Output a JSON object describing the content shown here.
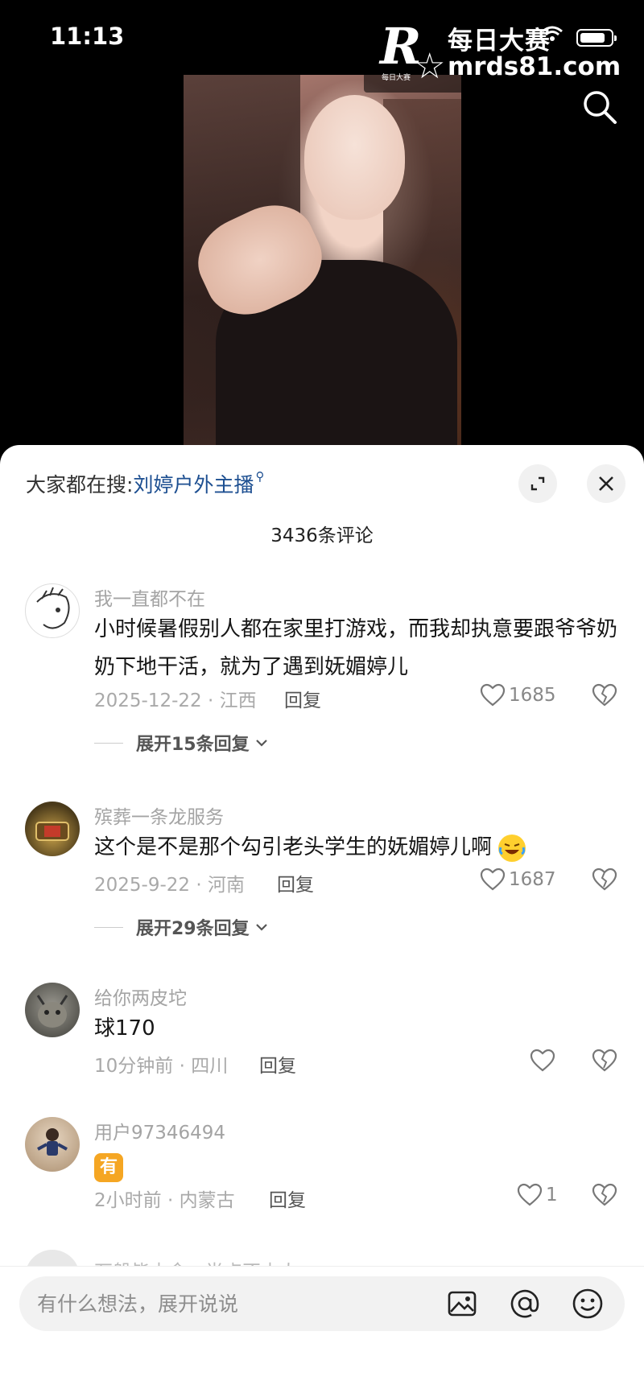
{
  "status": {
    "time": "11:13"
  },
  "watermark": {
    "logo_letter": "R",
    "logo_small": "每日大赛",
    "title": "每日大赛",
    "url": "mrds81.com"
  },
  "header": {
    "trending_label": "大家都在搜:",
    "trending_keyword": "刘婷户外主播",
    "comment_count": "3436条评论"
  },
  "comments": [
    {
      "user": "我一直都不在",
      "text": "小时候暑假别人都在家里打游戏，而我却执意要跟爷爷奶奶下地干活，就为了遇到妩媚婷儿",
      "meta": "2025-12-22 · 江西",
      "reply": "回复",
      "likes": "1685",
      "expand": "展开15条回复"
    },
    {
      "user": "殡葬一条龙服务",
      "text": "这个是不是那个勾引老头学生的妩媚婷儿啊",
      "meta": "2025-9-22 · 河南",
      "reply": "回复",
      "likes": "1687",
      "expand": "展开29条回复"
    },
    {
      "user": "给你两皮坨",
      "text": "球170",
      "meta": "10分钟前 · 四川",
      "reply": "回复",
      "likes": ""
    },
    {
      "user": "用户97346494",
      "emoji_text": "有",
      "meta": "2小时前 · 内蒙古",
      "reply": "回复",
      "likes": "1"
    },
    {
      "user": "万般皆由命，半点不由人"
    }
  ],
  "input": {
    "placeholder": "有什么想法，展开说说"
  },
  "icons": [
    "search-icon",
    "expand-icon",
    "close-icon",
    "heart-icon",
    "broken-heart-icon",
    "chevron-down-icon",
    "image-icon",
    "at-icon",
    "emoji-icon",
    "wifi-icon",
    "battery-icon"
  ]
}
